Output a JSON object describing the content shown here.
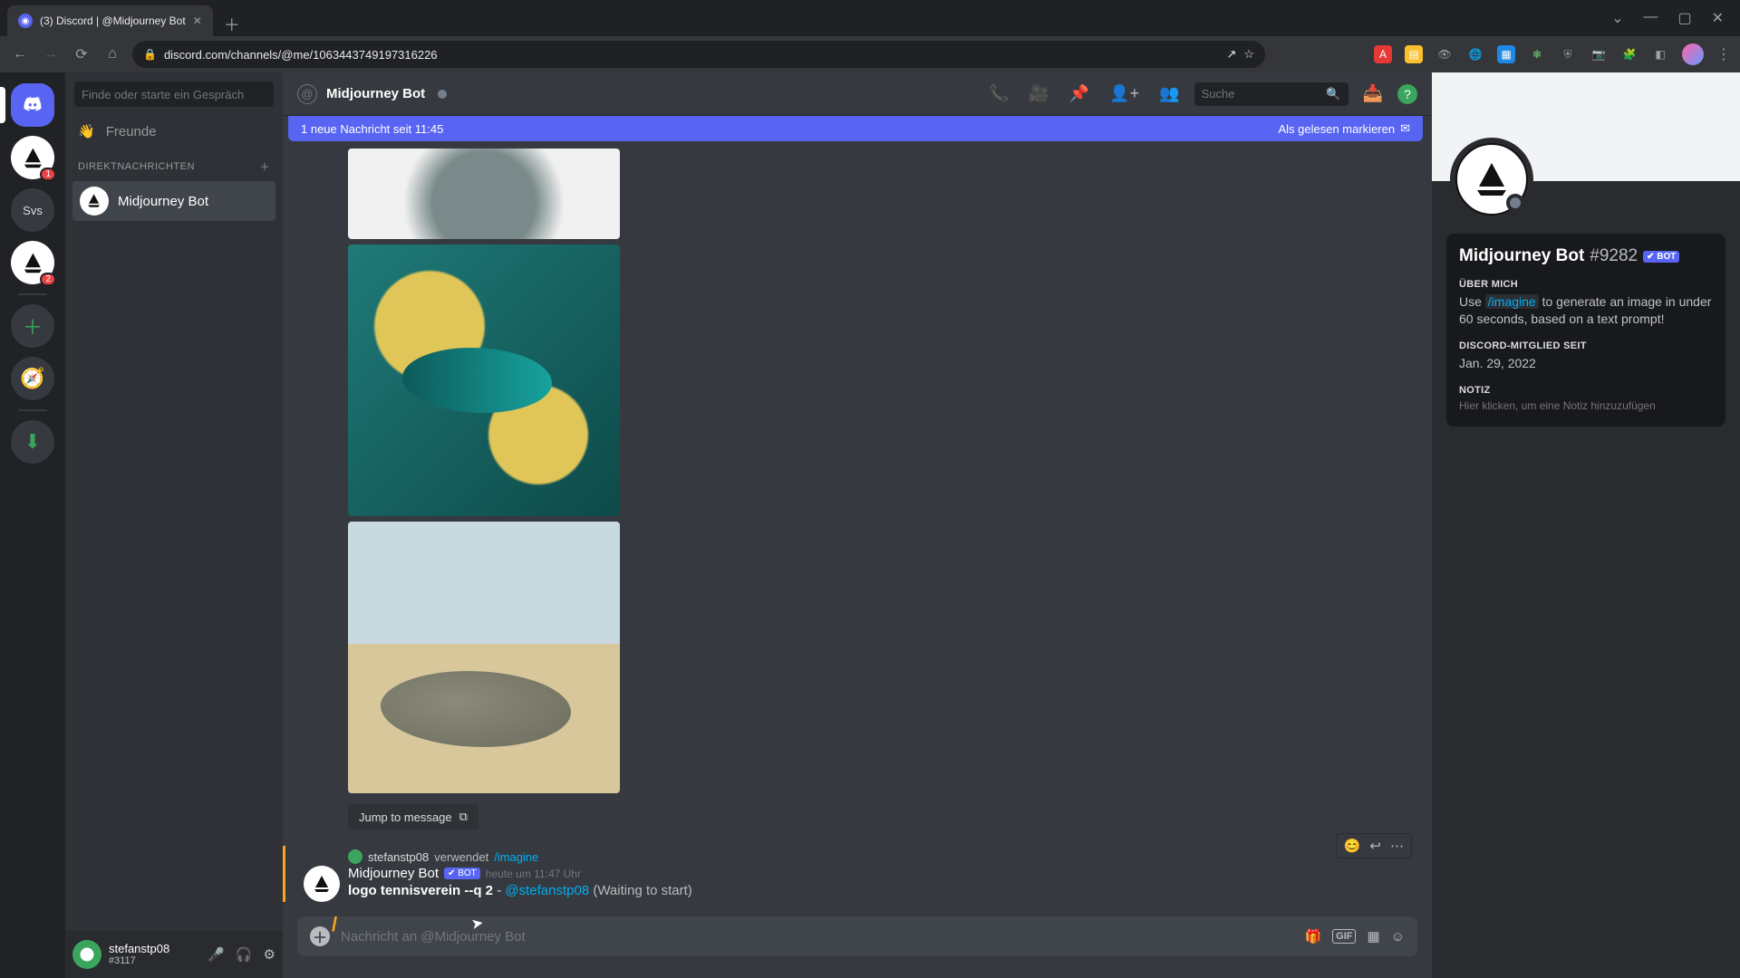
{
  "browser": {
    "tab_title": "(3) Discord | @Midjourney Bot",
    "url": "discord.com/channels/@me/1063443749197316226",
    "window_controls": {
      "min": "—",
      "max": "▢",
      "close": "✕"
    },
    "nav": {
      "back": "←",
      "fwd": "→",
      "reload": "⟳",
      "home": "⌂"
    },
    "omni_actions": {
      "share": "↗",
      "star": "☆"
    },
    "extensions": [
      "abp",
      "note",
      "eye",
      "globe",
      "grid1",
      "grid2",
      "shield",
      "cam",
      "puzzle",
      "panel"
    ],
    "menu": "⋮"
  },
  "rail": {
    "items": [
      {
        "k": "home",
        "badge": ""
      },
      {
        "k": "mj",
        "badge": "1"
      },
      {
        "k": "svs",
        "label": "Svs",
        "badge": ""
      },
      {
        "k": "srv2",
        "badge": "2"
      }
    ],
    "add": "＋",
    "explore": "🧭",
    "download": "⬇"
  },
  "dm": {
    "search_ph": "Finde oder starte ein Gespräch",
    "friends": "Freunde",
    "section": "DIREKTNACHRICHTEN",
    "add": "＋",
    "items": [
      {
        "name": "Midjourney Bot"
      }
    ],
    "footer": {
      "name": "stefanstp08",
      "tag": "#3117"
    }
  },
  "header": {
    "title": "Midjourney Bot",
    "search_ph": "Suche",
    "icons": {
      "call": "📞",
      "video": "🎥",
      "pin": "📌",
      "add": "👤+",
      "users": "👥",
      "inbox": "📥",
      "help": "?"
    }
  },
  "banner": {
    "left": "1 neue Nachricht seit 11:45",
    "right": "Als gelesen markieren",
    "icon": "✉"
  },
  "chat": {
    "jump": "Jump to message",
    "reply": {
      "user": "stefanstp08",
      "verb": "verwendet",
      "cmd": "/imagine"
    },
    "bot_name": "Midjourney Bot",
    "bot_tag": "✔ BOT",
    "timestamp": "heute um 11:47 Uhr",
    "prompt": "logo tennisverein --q 2",
    "sep": " - ",
    "mention": "@stefanstp08",
    "status": " (Waiting to start)",
    "actions": {
      "react": "😊",
      "reply": "↩",
      "more": "⋯"
    }
  },
  "compose": {
    "placeholder": "Nachricht an @Midjourney Bot",
    "slash": "/",
    "icons": {
      "gift": "🎁",
      "gif": "GIF",
      "sticker": "▦",
      "emoji": "☺"
    }
  },
  "profile": {
    "name": "Midjourney Bot",
    "disc": "#9282",
    "bot_tag": "✔ BOT",
    "about_h": "ÜBER MICH",
    "about_pre": "Use ",
    "about_cmd": "/imagine",
    "about_post": " to generate an image in under 60 seconds, based on a text prompt!",
    "member_h": "DISCORD-MITGLIED SEIT",
    "member_v": "Jan. 29, 2022",
    "note_h": "NOTIZ",
    "note_ph": "Hier klicken, um eine Notiz hinzuzufügen"
  }
}
